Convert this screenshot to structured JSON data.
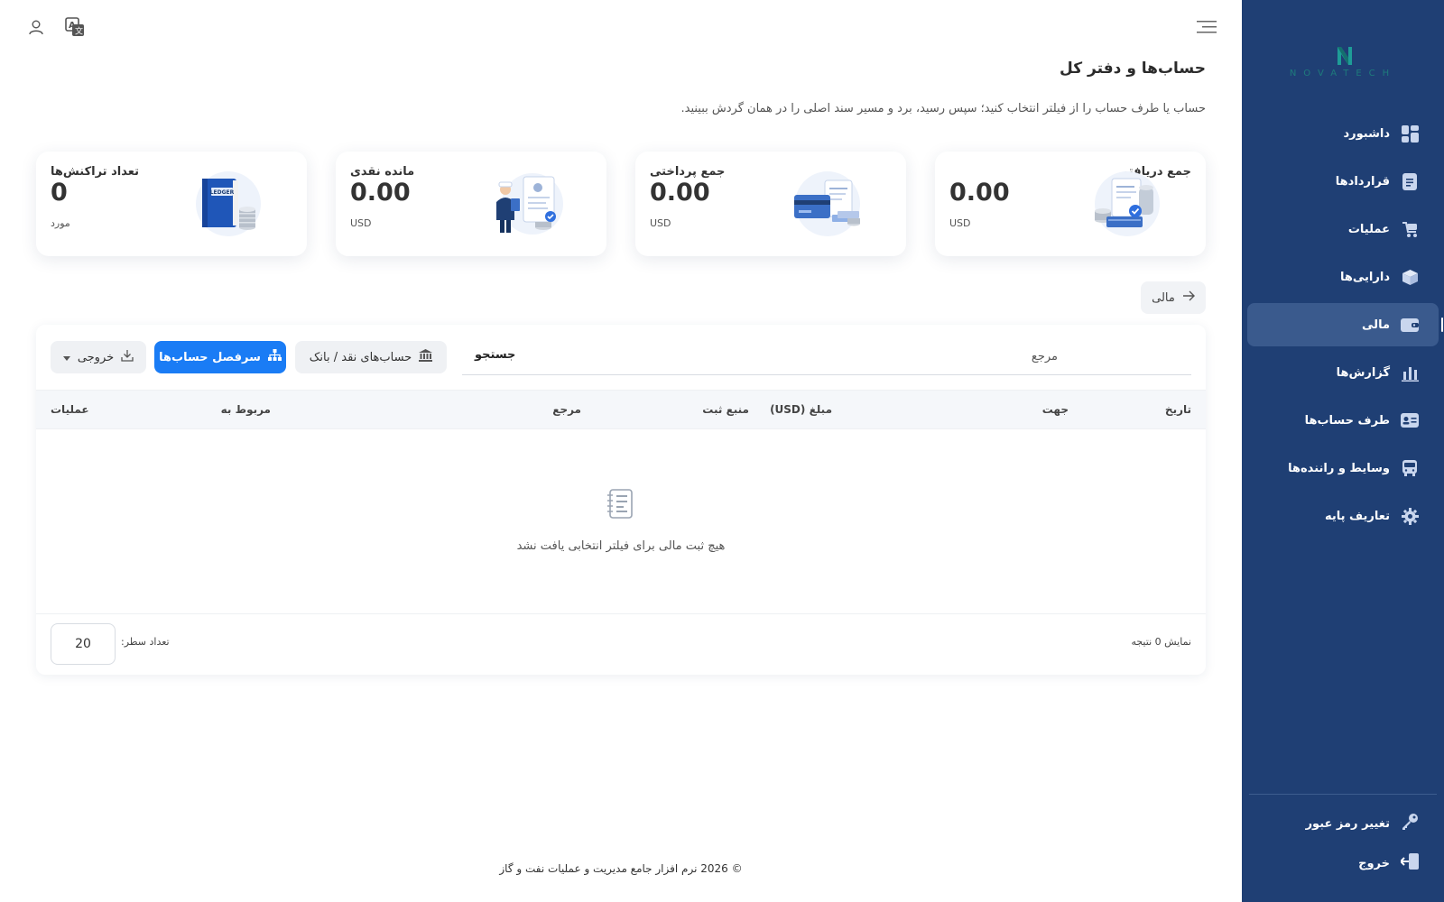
{
  "sidebar": {
    "logo_text": "NOVATECH",
    "items": [
      {
        "label": "داشبورد",
        "icon": "dashboard-icon"
      },
      {
        "label": "قراردادها",
        "icon": "contract-icon"
      },
      {
        "label": "عملیات",
        "icon": "operations-icon"
      },
      {
        "label": "دارایی‌ها",
        "icon": "cube-icon"
      },
      {
        "label": "مالی",
        "icon": "wallet-icon"
      },
      {
        "label": "گزارش‌ها",
        "icon": "bar-chart-icon"
      },
      {
        "label": "طرف حساب‌ها",
        "icon": "id-card-icon"
      },
      {
        "label": "وسایط و راننده‌ها",
        "icon": "bus-icon"
      },
      {
        "label": "تعاریف پایه",
        "icon": "gear-icon"
      }
    ],
    "active_index": 4,
    "change_password": "تغییر رمز عبور",
    "logout": "خروج"
  },
  "page": {
    "title": "حساب‌ها و دفتر کل",
    "subtitle": "حساب یا طرف حساب را از فیلتر انتخاب کنید؛ سپس رسید، برد و مسیر سند اصلی را در همان گردش ببینید."
  },
  "cards": [
    {
      "title": "جمع دریافتی",
      "value": "0.00",
      "unit": "USD"
    },
    {
      "title": "جمع پرداختی",
      "value": "0.00",
      "unit": "USD"
    },
    {
      "title": "مانده نقدی",
      "value": "0.00",
      "unit": "USD"
    },
    {
      "title": "تعداد تراکنش‌ها",
      "value": "0",
      "unit": "مورد",
      "illustration_label": "LEDGER"
    }
  ],
  "breadcrumb": {
    "label": "مالی"
  },
  "toolbar": {
    "search_tab": "جستجو",
    "search_placeholder": "مرجع",
    "banks_button": "حساب‌های نقد / بانک",
    "chart_button": "سرفصل حساب‌ها",
    "export_button": "خروجی"
  },
  "table": {
    "columns": [
      "تاریخ",
      "جهت",
      "مبلغ (USD)",
      "منبع ثبت",
      "مرجع",
      "مربوط به",
      "عملیات"
    ],
    "empty_message": "هیچ ثبت مالی برای فیلتر انتخابی یافت نشد"
  },
  "pagination": {
    "results_text": "نمایش 0 نتیجه",
    "rows_label": "تعداد سطر:",
    "rows_value": "20"
  },
  "footer": {
    "text": "© 2026 نرم افزار جامع مدیریت و عملیات نفت و گاز"
  },
  "colors": {
    "sidebar": "#1f3f74",
    "sidebar_active": "#3a5a8d",
    "primary": "#1a7cf5",
    "logo": "#1e7b7c"
  }
}
